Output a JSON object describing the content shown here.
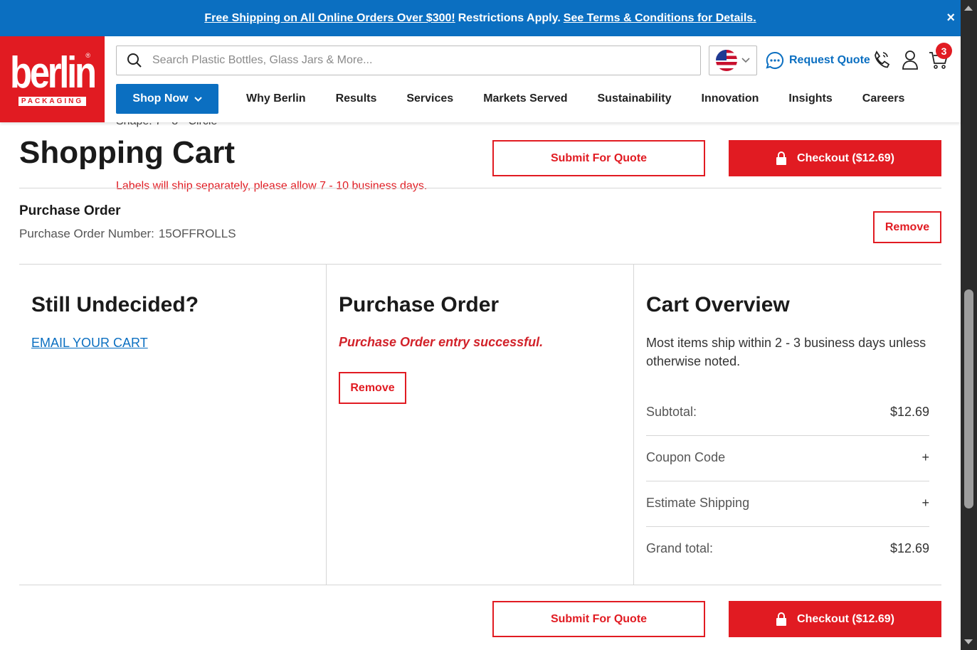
{
  "promo": {
    "link1": "Free Shipping on All Online Orders Over $300!",
    "middle": "Restrictions Apply.",
    "link2": "See Terms & Conditions for Details.",
    "close": "×"
  },
  "header": {
    "logo_word": "berlin",
    "logo_sub": "PACKAGING",
    "logo_reg": "®",
    "search_placeholder": "Search Plastic Bottles, Glass Jars & More...",
    "request_quote": "Request Quote",
    "cart_count": "3",
    "shop_now": "Shop Now",
    "nav": [
      "Why Berlin",
      "Results",
      "Services",
      "Markets Served",
      "Sustainability",
      "Innovation",
      "Insights",
      "Careers"
    ]
  },
  "ghost": {
    "line1": "Shape: 7 - 8 - Circle",
    "line2": "Labels will ship separately, please allow 7 - 10 business days."
  },
  "cart": {
    "title": "Shopping Cart",
    "submit_quote": "Submit For Quote",
    "checkout": "Checkout ($12.69)",
    "po_heading": "Purchase Order",
    "po_number_label": "Purchase Order Number:",
    "po_number_value": "15OFFROLLS",
    "remove": "Remove"
  },
  "columns": {
    "undecided_title": "Still Undecided?",
    "email_cart": "EMAIL YOUR CART",
    "po_title": "Purchase Order",
    "po_success": "Purchase Order entry successful.",
    "po_remove": "Remove",
    "overview_title": "Cart Overview",
    "overview_note": "Most items ship within 2 - 3 business days unless otherwise noted.",
    "subtotal_label": "Subtotal:",
    "subtotal_value": "$12.69",
    "coupon_label": "Coupon Code",
    "estimate_label": "Estimate Shipping",
    "plus": "+",
    "grand_label": "Grand total:",
    "grand_value": "$12.69"
  },
  "colors": {
    "brand_red": "#e11b22",
    "brand_blue": "#0b6fc1"
  }
}
